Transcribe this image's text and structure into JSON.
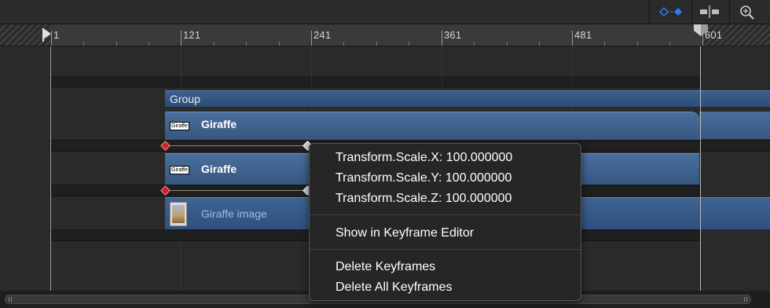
{
  "ruler": {
    "ticks": [
      "1",
      "121",
      "241",
      "361",
      "481",
      "601"
    ]
  },
  "tracks": {
    "group_label": "Group",
    "layer1_badge": "Giraffe",
    "layer1_label": "Giraffe",
    "layer2_badge": "Giraffe",
    "layer2_label": "Giraffe",
    "image_label": "Giraffe image"
  },
  "context_menu": {
    "items": [
      "Transform.Scale.X: 100.000000",
      "Transform.Scale.Y: 100.000000",
      "Transform.Scale.Z: 100.000000",
      "Show in Keyframe Editor",
      "Delete Keyframes",
      "Delete All Keyframes"
    ]
  },
  "colors": {
    "track_bar": "#3f6391",
    "keyframe_red": "#c0282d",
    "accent_blue": "#2f7bf0"
  },
  "icons": [
    "keyframe-nav-icon",
    "snapping-icon",
    "zoom-icon",
    "playhead-start-icon",
    "playhead-end-icon"
  ]
}
